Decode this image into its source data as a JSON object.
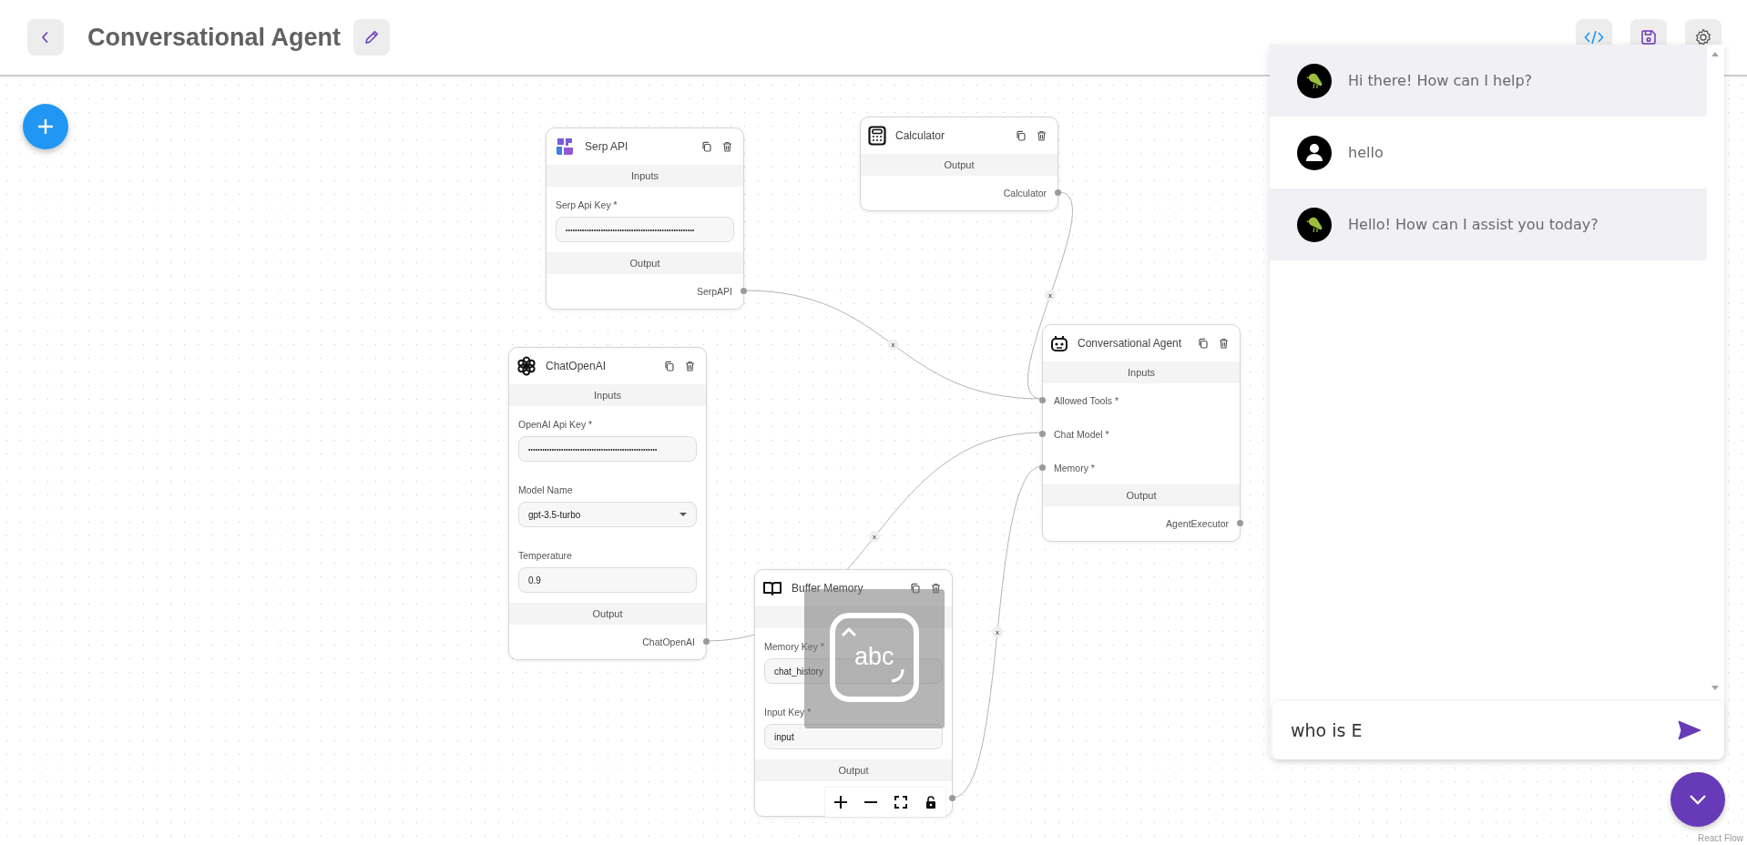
{
  "header": {
    "title": "Conversational Agent"
  },
  "nodes": [
    {
      "kind": "serp",
      "title": "Serp API",
      "sections": [
        {
          "kind": "inputs",
          "label": "Inputs",
          "fields": [
            {
              "kind": "password",
              "label": "Serp Api Key *",
              "value": "•••••••••••••••••••••••••••••••••••••••••••••••••••••••"
            }
          ]
        },
        {
          "kind": "output",
          "label": "Output",
          "outputs": [
            "SerpAPI"
          ]
        }
      ]
    },
    {
      "kind": "calculator",
      "title": "Calculator",
      "sections": [
        {
          "kind": "output",
          "label": "Output",
          "outputs": [
            "Calculator"
          ]
        }
      ]
    },
    {
      "kind": "openai",
      "title": "ChatOpenAI",
      "sections": [
        {
          "kind": "inputs",
          "label": "Inputs",
          "fields": [
            {
              "kind": "password",
              "label": "OpenAI Api Key *",
              "value": "•••••••••••••••••••••••••••••••••••••••••••••••••••••••"
            },
            {
              "kind": "select",
              "label": "Model Name",
              "value": "gpt-3.5-turbo"
            },
            {
              "kind": "text",
              "label": "Temperature",
              "value": "0.9"
            }
          ]
        },
        {
          "kind": "output",
          "label": "Output",
          "outputs": [
            "ChatOpenAI"
          ]
        }
      ]
    },
    {
      "kind": "agent",
      "title": "Conversational Agent",
      "sections": [
        {
          "kind": "inputs",
          "label": "Inputs",
          "fields": [
            {
              "kind": "handle",
              "label": "Allowed Tools *"
            },
            {
              "kind": "handle",
              "label": "Chat Model *"
            },
            {
              "kind": "handle",
              "label": "Memory *"
            }
          ]
        },
        {
          "kind": "output",
          "label": "Output",
          "outputs": [
            "AgentExecutor"
          ]
        }
      ]
    },
    {
      "kind": "memory",
      "title": "Buffer Memory",
      "sections": [
        {
          "kind": "inputs",
          "fields": [
            {
              "kind": "text",
              "label": "Memory Key *",
              "value": "chat_history"
            },
            {
              "kind": "text",
              "label": "Input Key *",
              "value": "input"
            }
          ]
        },
        {
          "kind": "output",
          "label": "Output"
        }
      ]
    }
  ],
  "edges": [
    {
      "label": "x"
    },
    {
      "label": "x"
    },
    {
      "label": "x"
    },
    {
      "label": "x"
    }
  ],
  "ime_indicator": {
    "label": "abc"
  },
  "attribution": "React Flow",
  "chat": {
    "messages": [
      {
        "kind": "bot",
        "text": "Hi there! How can I help?"
      },
      {
        "kind": "user",
        "text": "hello"
      },
      {
        "kind": "bot",
        "text": "Hello! How can I assist you today?"
      }
    ],
    "input": {
      "value": "who is E"
    }
  }
}
